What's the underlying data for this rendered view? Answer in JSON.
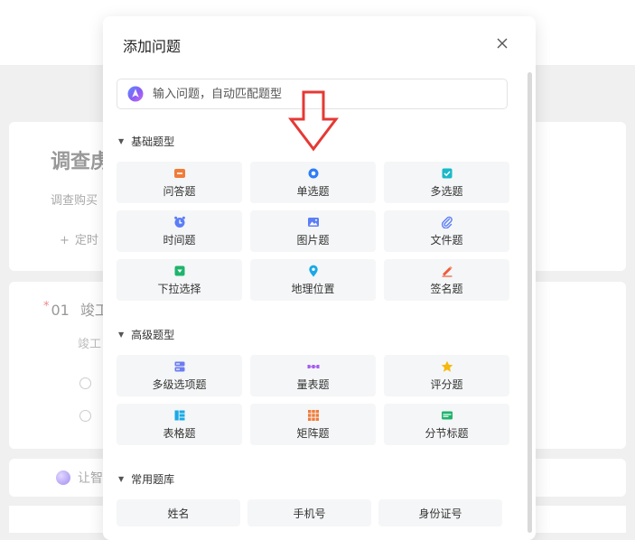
{
  "background": {
    "title": "调查虏",
    "description": "调查购买",
    "add_button": "定时",
    "question_number": "01",
    "question_title": "竣工",
    "question_sub": "竣工",
    "ai_text": "让智"
  },
  "modal": {
    "title": "添加问题",
    "search_placeholder": "输入问题，自动匹配题型",
    "basic_section": {
      "title": "基础题型",
      "items": [
        {
          "label": "问答题",
          "icon": "qa-icon",
          "color": "#f07c3a"
        },
        {
          "label": "单选题",
          "icon": "radio-icon",
          "color": "#2f7df6"
        },
        {
          "label": "多选题",
          "icon": "checkbox-icon",
          "color": "#19b9c9"
        },
        {
          "label": "时间题",
          "icon": "clock-icon",
          "color": "#5b7ef7"
        },
        {
          "label": "图片题",
          "icon": "image-icon",
          "color": "#5b7ef7"
        },
        {
          "label": "文件题",
          "icon": "paperclip-icon",
          "color": "#5b7ef7"
        },
        {
          "label": "下拉选择",
          "icon": "dropdown-icon",
          "color": "#1fb46d"
        },
        {
          "label": "地理位置",
          "icon": "location-pin-icon",
          "color": "#1aa9e6"
        },
        {
          "label": "签名题",
          "icon": "signature-icon",
          "color": "#f05a3a"
        }
      ]
    },
    "advanced_section": {
      "title": "高级题型",
      "items": [
        {
          "label": "多级选项题",
          "icon": "multilevel-icon",
          "color": "#6c7cf2"
        },
        {
          "label": "量表题",
          "icon": "scale-icon",
          "color": "#a55cf0"
        },
        {
          "label": "评分题",
          "icon": "star-icon",
          "color": "#f5b90c"
        },
        {
          "label": "表格题",
          "icon": "table-icon",
          "color": "#1aa9e6"
        },
        {
          "label": "矩阵题",
          "icon": "matrix-icon",
          "color": "#f07c3a"
        },
        {
          "label": "分节标题",
          "icon": "section-icon",
          "color": "#1fb46d"
        }
      ]
    },
    "library_section": {
      "title": "常用题库",
      "items": [
        {
          "label": "姓名"
        },
        {
          "label": "手机号"
        },
        {
          "label": "身份证号"
        }
      ]
    }
  },
  "colors": {
    "arrow_annotation": "#e53935",
    "tile_bg": "#f5f6f7"
  }
}
